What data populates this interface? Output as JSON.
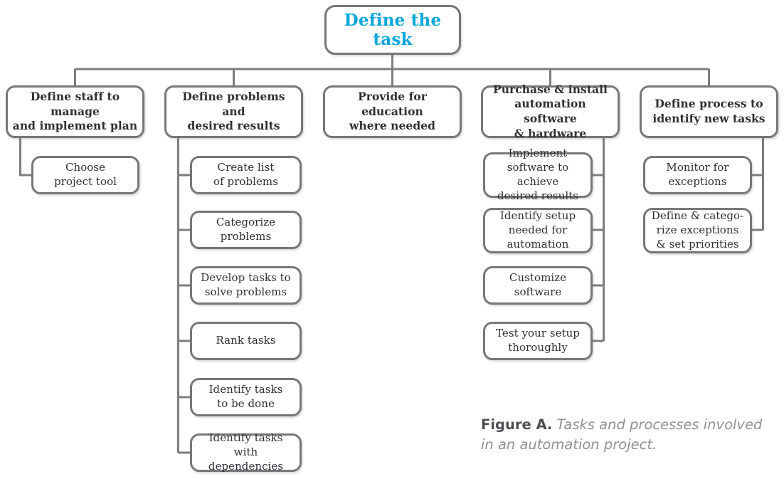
{
  "diagram": {
    "root": {
      "label": "Define the task",
      "color": "#00a5dd"
    },
    "branches": [
      {
        "label": "Define staff to manage\nand implement plan",
        "children": [
          {
            "label": "Choose\nproject tool"
          }
        ]
      },
      {
        "label": "Define problems and\ndesired results",
        "children": [
          {
            "label": "Create list\nof problems"
          },
          {
            "label": "Categorize\nproblems"
          },
          {
            "label": "Develop tasks to\nsolve problems"
          },
          {
            "label": "Rank tasks"
          },
          {
            "label": "Identify tasks\nto be done"
          },
          {
            "label": "Identify tasks with\ndependencies"
          }
        ]
      },
      {
        "label": "Provide for education\nwhere needed",
        "children": []
      },
      {
        "label": "Purchase & install\nautomation software\n& hardware",
        "children": [
          {
            "label": "Implement\nsoftware to achieve\ndesired results"
          },
          {
            "label": "Identify setup\nneeded for\nautomation"
          },
          {
            "label": "Customize\nsoftware"
          },
          {
            "label": "Test your setup\nthoroughly"
          }
        ]
      },
      {
        "label": "Define process to\nidentify new tasks",
        "children": [
          {
            "label": "Monitor for\nexceptions"
          },
          {
            "label": "Define & catego-\nrize exceptions\n& set priorities"
          }
        ]
      }
    ]
  },
  "caption": {
    "figure_label": "Figure A.",
    "figure_text": " Tasks and processes involved in an automation project."
  },
  "style": {
    "border_color": "#75777a",
    "text_color": "#2e3034",
    "accent_color": "#00a5dd",
    "caption_color": "#8e9195"
  }
}
